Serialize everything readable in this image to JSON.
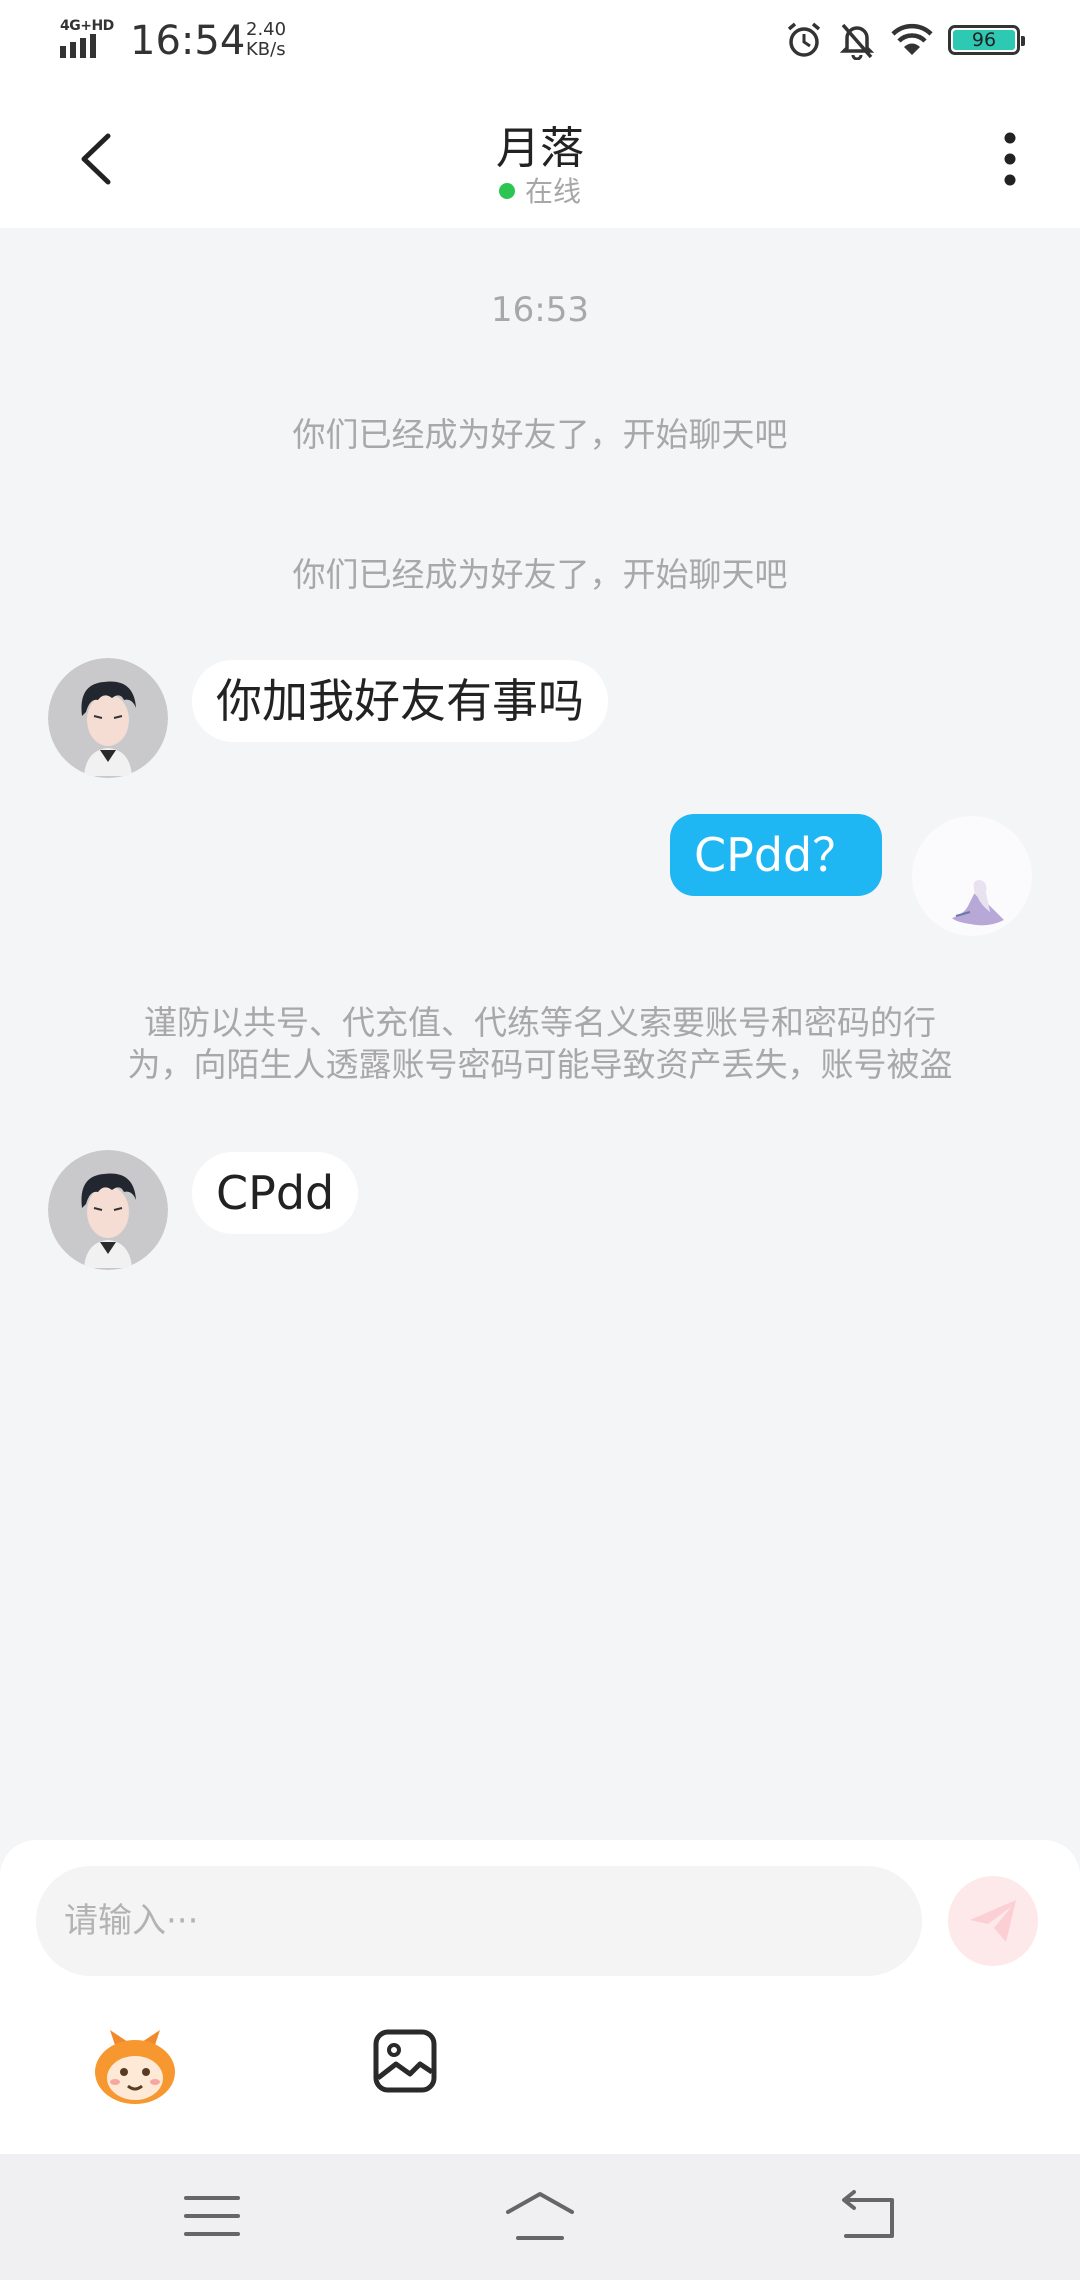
{
  "status_bar": {
    "network": "4G+HD",
    "time": "16:54",
    "speed_value": "2.40",
    "speed_unit": "KB/s",
    "battery": "96",
    "icons": [
      "alarm-icon",
      "bell-off-icon",
      "wifi-icon",
      "battery-icon"
    ]
  },
  "header": {
    "title": "月落",
    "status": "在线",
    "status_color": "#2bc552"
  },
  "chat": {
    "timestamp": "16:53",
    "system_msg_1": "你们已经成为好友了，开始聊天吧",
    "system_msg_2": "你们已经成为好友了，开始聊天吧",
    "msg_in_1": "你加我好友有事吗",
    "msg_out_1": "CPdd？",
    "warning_line_1": "谨防以共号、代充值、代练等名义索要账号和密码的行",
    "warning_line_2": "为，向陌生人透露账号密码可能导致资产丢失，账号被盗",
    "msg_in_2": "CPdd",
    "outgoing_bubble_color": "#1fb6f4"
  },
  "composer": {
    "placeholder": "请输入···"
  }
}
